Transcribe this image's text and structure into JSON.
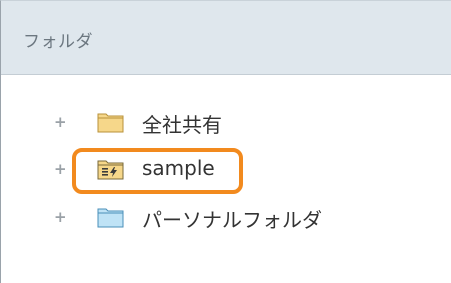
{
  "panel": {
    "title": "フォルダ"
  },
  "tree": {
    "items": [
      {
        "expander": "+",
        "label": "全社共有",
        "icon": "folder-icon"
      },
      {
        "expander": "+",
        "label": "sample",
        "icon": "folder-app-icon"
      },
      {
        "expander": "+",
        "label": "パーソナルフォルダ",
        "icon": "folder-personal-icon"
      }
    ]
  },
  "colors": {
    "folder_yellow": "#f6d78a",
    "folder_blue": "#bfe3f6",
    "highlight_orange": "#f28a1e"
  }
}
